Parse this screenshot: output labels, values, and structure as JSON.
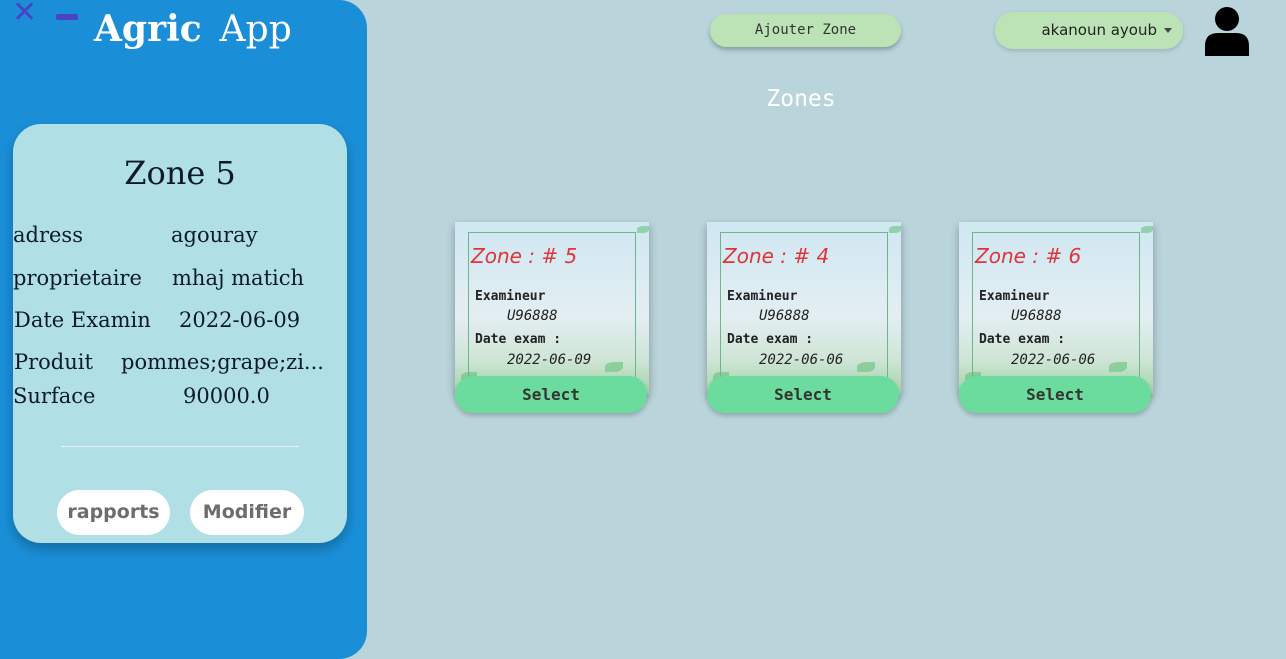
{
  "window": {
    "close_glyph": "✕"
  },
  "brand": {
    "bold": "Agric",
    "regular": "App"
  },
  "selected_zone": {
    "title": "Zone 5",
    "fields": [
      {
        "key": "adress",
        "value": "agouray"
      },
      {
        "key": "proprietaire",
        "value": "mhaj matich"
      },
      {
        "key": "Date Examin",
        "value": "2022-06-09"
      },
      {
        "key": "Produit",
        "value": "pommes;grape;zi..."
      },
      {
        "key": "Surface",
        "value": "90000.0"
      }
    ],
    "buttons": {
      "reports": "rapports",
      "edit": "Modifier"
    }
  },
  "topbar": {
    "add_zone": "Ajouter Zone",
    "user_name": "akanoun ayoub",
    "accent_color": "#bce3b6"
  },
  "page_title": "Zones",
  "zones": [
    {
      "heading": "Zone : # 5",
      "examiner_label": "Examineur",
      "examiner": "U96888",
      "date_label": "Date exam :",
      "date": "2022-06-09",
      "select": "Select"
    },
    {
      "heading": "Zone : # 4",
      "examiner_label": "Examineur",
      "examiner": "U96888",
      "date_label": "Date exam :",
      "date": "2022-06-06",
      "select": "Select"
    },
    {
      "heading": "Zone : # 6",
      "examiner_label": "Examineur",
      "examiner": "U96888",
      "date_label": "Date exam :",
      "date": "2022-06-06",
      "select": "Select"
    }
  ],
  "colors": {
    "sidebar": "#1a8fd8",
    "background": "#b9d4db",
    "select_button": "#6cdc9e",
    "zone_heading": "#e0343a"
  }
}
